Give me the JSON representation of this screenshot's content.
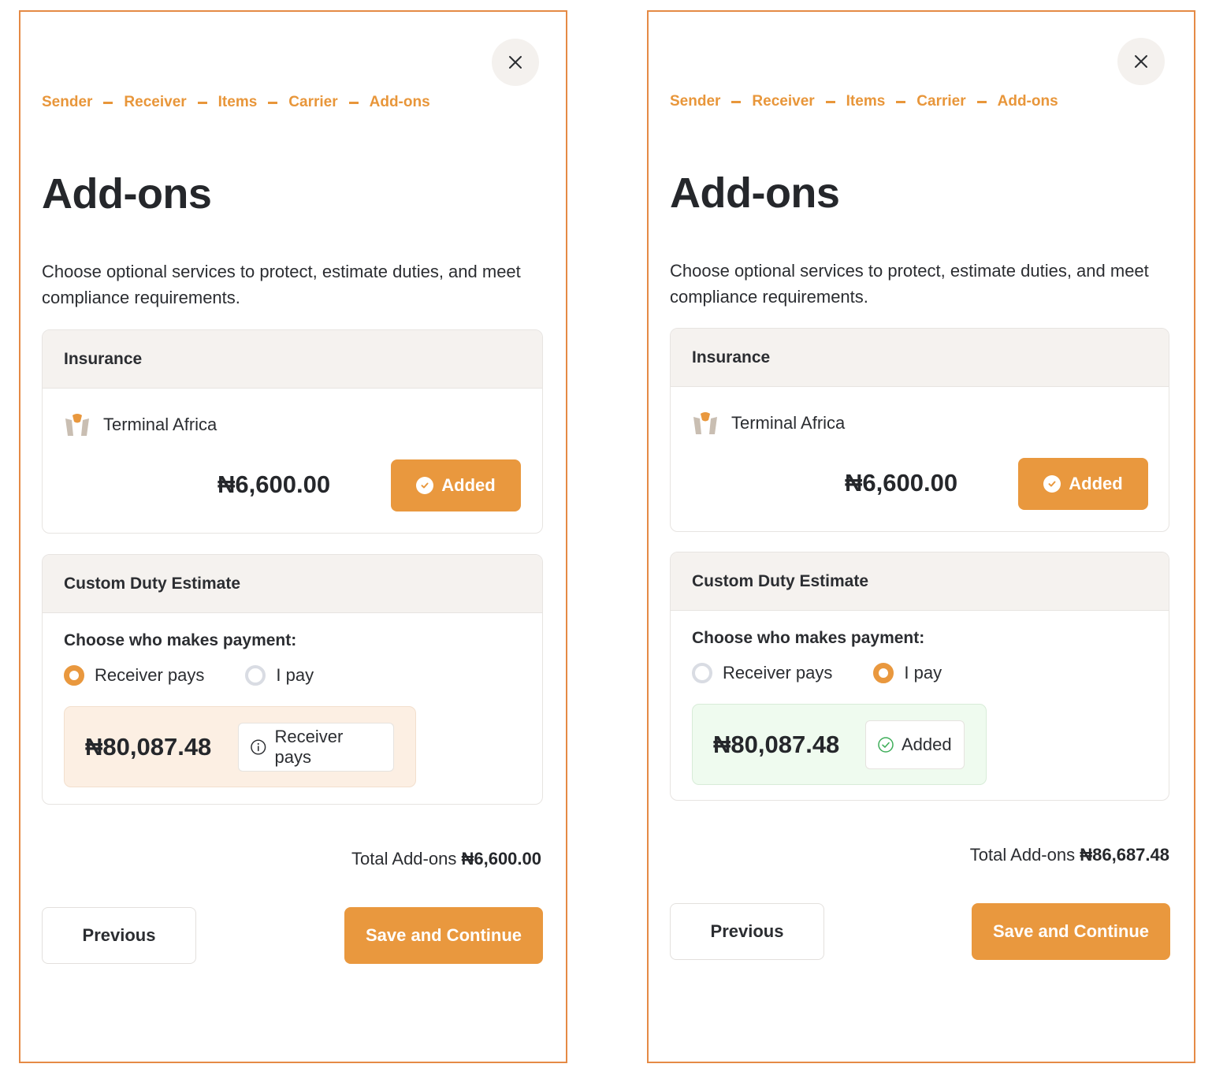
{
  "panels": [
    {
      "steps": [
        "Sender",
        "Receiver",
        "Items",
        "Carrier",
        "Add-ons"
      ],
      "title": "Add-ons",
      "description": "Choose optional services to protect, estimate duties, and meet compliance requirements.",
      "insurance": {
        "heading": "Insurance",
        "provider": "Terminal Africa",
        "price": "₦6,600.00",
        "button_label": "Added"
      },
      "duty": {
        "heading": "Custom Duty Estimate",
        "prompt": "Choose who makes payment:",
        "options": [
          "Receiver pays",
          "I pay"
        ],
        "selected": "Receiver pays",
        "amount": "₦80,087.48",
        "badge": "Receiver pays"
      },
      "total_label": "Total Add-ons",
      "total_value": "₦6,600.00",
      "previous_label": "Previous",
      "save_label": "Save and Continue"
    },
    {
      "steps": [
        "Sender",
        "Receiver",
        "Items",
        "Carrier",
        "Add-ons"
      ],
      "title": "Add-ons",
      "description": "Choose optional services to protect, estimate duties, and meet compliance requirements.",
      "insurance": {
        "heading": "Insurance",
        "provider": "Terminal Africa",
        "price": "₦6,600.00",
        "button_label": "Added"
      },
      "duty": {
        "heading": "Custom Duty Estimate",
        "prompt": "Choose who makes payment:",
        "options": [
          "Receiver pays",
          "I pay"
        ],
        "selected": "I pay",
        "amount": "₦80,087.48",
        "badge": "Added"
      },
      "total_label": "Total Add-ons",
      "total_value": "₦86,687.48",
      "previous_label": "Previous",
      "save_label": "Save and Continue"
    }
  ],
  "colors": {
    "accent": "#e9983e",
    "panel_border": "#e58a45",
    "receiver_box_bg": "#fcefe3",
    "added_box_bg": "#effbef",
    "success_icon": "#3fae5a"
  }
}
